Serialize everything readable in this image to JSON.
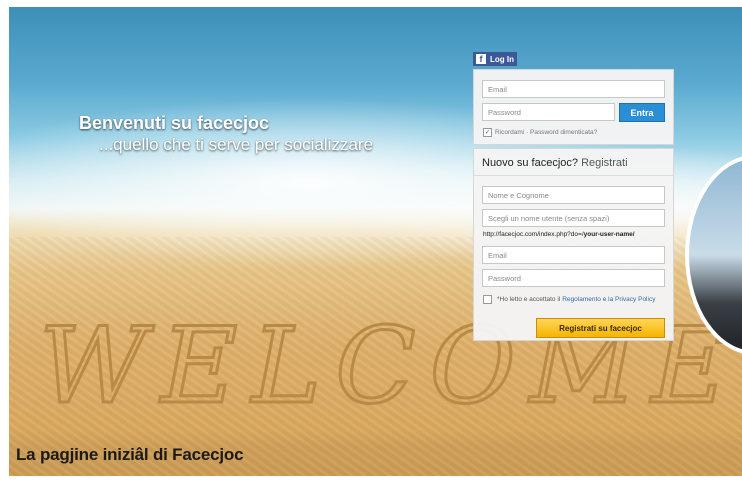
{
  "hero": {
    "welcome_title": "Benvenuti su facecjoc",
    "welcome_subtitle": "...quello che ti serve per socializzare",
    "sand_text": "WELCOME"
  },
  "login": {
    "fb_button_label": "Log In",
    "email_placeholder": "Email",
    "password_placeholder": "Password",
    "submit_label": "Entra",
    "remember_text": "Ricordami · Password dimenticata?",
    "remember_checked": true
  },
  "register": {
    "title": "Nuovo su facecjoc?",
    "title_link": "Registrati",
    "name_placeholder": "Nome e Cognome",
    "username_placeholder": "Scegli un nome utente (senza spazi)",
    "url_prefix": "http://facecjoc.com/index.php?do=/",
    "url_suffix": "your-user-name/",
    "email_placeholder": "Email",
    "password_placeholder": "Password",
    "terms_text": "*Ho letto e accettato il",
    "terms_link": "Regolamento e la Privacy Policy",
    "submit_label": "Registrati su facecjoc"
  },
  "caption": "La pagjine iniziâl di Facecjoc",
  "colors": {
    "facebook_blue": "#3b5998",
    "entra_blue": "#2b8fd6",
    "register_yellow": "#f5b400"
  }
}
